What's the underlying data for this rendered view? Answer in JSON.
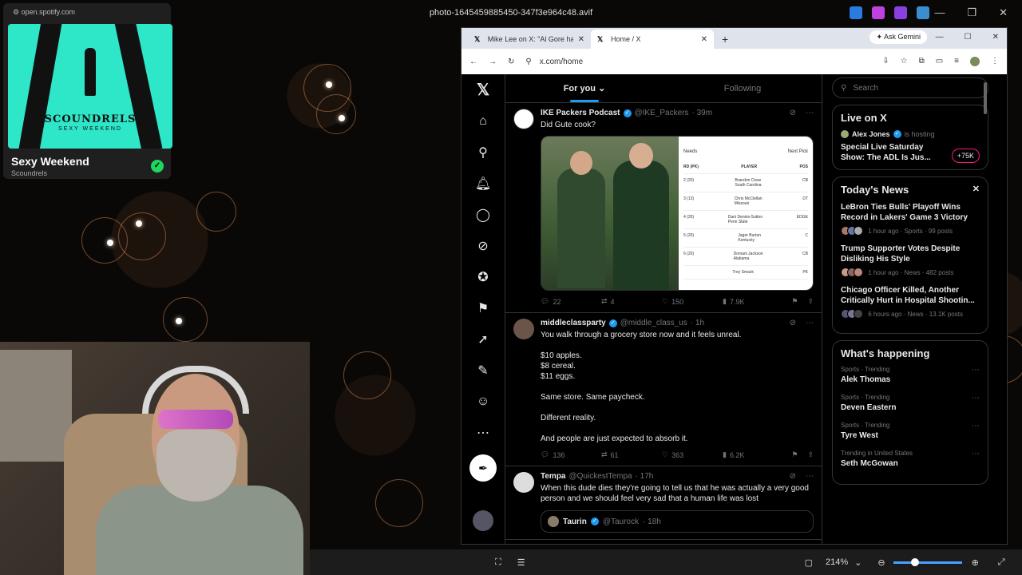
{
  "viewer": {
    "title": "photo-1645459885450-347f3e964c48.avif",
    "zoom": "214%"
  },
  "spotify": {
    "url": "open.spotify.com",
    "band_art": "SCOUNDRELS",
    "album_art": "SEXY WEEKEND",
    "track": "Sexy Weekend",
    "artist": "Scoundrels"
  },
  "browser": {
    "tabs": [
      {
        "label": "Mike Lee on X: \"Al Gore has cal",
        "active": false
      },
      {
        "label": "Home / X",
        "active": true
      }
    ],
    "gemini_label": "Ask Gemini",
    "address": "x.com/home"
  },
  "feed": {
    "tabs": [
      {
        "label": "For you"
      },
      {
        "label": "Following"
      }
    ],
    "tweets": [
      {
        "name": "IKE Packers Podcast",
        "handle": "@IKE_Packers",
        "time": "· 39m",
        "text": "Did Gute cook?",
        "replies": "22",
        "reposts": "4",
        "likes": "150",
        "views": "7.9K",
        "draft": {
          "needs_label": "Needs",
          "next_pick": "Next Pick",
          "headers": [
            "RD (PK)",
            "PLAYER",
            "POS"
          ],
          "rows": [
            {
              "rd": "2 (20)",
              "player": "Brandon Cisse",
              "school": "South Carolina",
              "pos": "CB"
            },
            {
              "rd": "3 (13)",
              "player": "Chris McClellan",
              "school": "Missouri",
              "pos": "DT"
            },
            {
              "rd": "4 (20)",
              "player": "Dani Dennis-Sutton",
              "school": "Penn State",
              "pos": "EDGE"
            },
            {
              "rd": "5 (20)",
              "player": "Jager Burton",
              "school": "Kentucky",
              "pos": "C"
            },
            {
              "rd": "6 (20)",
              "player": "Domani Jackson",
              "school": "Alabama",
              "pos": "CB"
            },
            {
              "rd": "",
              "player": "Trey Smack",
              "school": "",
              "pos": "PK"
            }
          ]
        }
      },
      {
        "name": "middleclassparty",
        "handle": "@middle_class_us",
        "time": "· 1h",
        "text": "You walk through a grocery store now and it feels unreal.\n\n$10 apples.\n$8 cereal.\n$11 eggs.\n\nSame store. Same paycheck.\n\nDifferent reality.\n\nAnd people are just expected to absorb it.",
        "replies": "136",
        "reposts": "61",
        "likes": "363",
        "views": "6.2K"
      },
      {
        "name": "Tempa",
        "handle": "@QuickestTempa",
        "time": "· 17h",
        "text": "When this dude dies they're going to tell us that he was actually a very good person and we should feel very sad that a human life was lost",
        "quote": {
          "name": "Taurin",
          "handle": "@Taurock",
          "time": "· 18h"
        }
      }
    ]
  },
  "sidebar": {
    "search_placeholder": "Search",
    "live": {
      "title": "Live on X",
      "host": "Alex Jones",
      "hosting": "is hosting",
      "space_title": "Special Live Saturday Show: The ADL Is Jus...",
      "count": "+75K"
    },
    "news": {
      "title": "Today's News",
      "items": [
        {
          "title": "LeBron Ties Bulls' Playoff Wins Record in Lakers' Game 3 Victory",
          "meta": "1 hour ago · Sports · 99 posts"
        },
        {
          "title": "Trump Supporter Votes Despite Disliking His Style",
          "meta": "1 hour ago · News · 482 posts"
        },
        {
          "title": "Chicago Officer Killed, Another Critically Hurt in Hospital Shootin...",
          "meta": "6 hours ago · News · 13.1K posts"
        }
      ]
    },
    "happening": {
      "title": "What's happening",
      "items": [
        {
          "category": "Sports · Trending",
          "name": "Alek Thomas"
        },
        {
          "category": "Sports · Trending",
          "name": "Deven Eastern"
        },
        {
          "category": "Sports · Trending",
          "name": "Tyre West"
        },
        {
          "category": "Trending in United States",
          "name": "Seth McGowan"
        }
      ]
    }
  },
  "colors": {
    "x_blue": "#1d9bf0",
    "spotify_green": "#1ed760",
    "live_pink": "#f91880"
  }
}
